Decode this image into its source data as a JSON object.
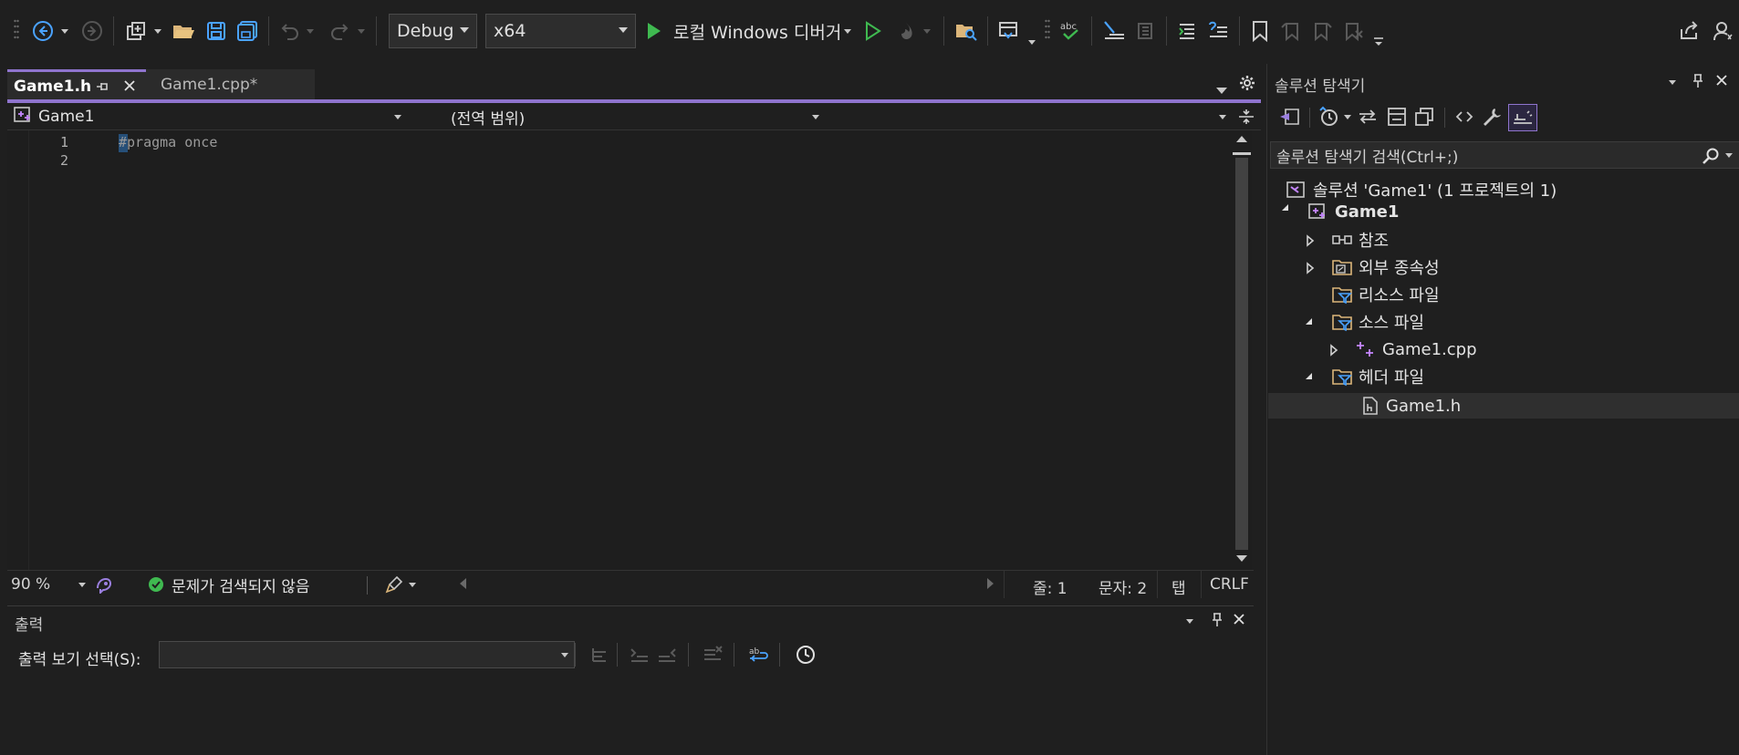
{
  "toolbar": {
    "config": "Debug",
    "platform": "x64",
    "run_label": "로컬 Windows 디버거"
  },
  "tabs": [
    {
      "label": "Game1.h",
      "active": true
    },
    {
      "label": "Game1.cpp*",
      "active": false
    }
  ],
  "navbar": {
    "project": "Game1",
    "scope": "(전역 범위)",
    "member": ""
  },
  "editor": {
    "lines": [
      {
        "number": "1",
        "text": "#pragma once"
      },
      {
        "number": "2",
        "text": ""
      }
    ]
  },
  "statusbar": {
    "zoom": "90 %",
    "issues": "문제가 검색되지 않음",
    "line": "줄: 1",
    "char": "문자: 2",
    "indent": "탭",
    "eol": "CRLF"
  },
  "output": {
    "title": "출력",
    "source_label": "출력 보기 선택(S):",
    "source_value": ""
  },
  "explorer": {
    "title": "솔루션 탐색기",
    "search_placeholder": "솔루션 탐색기 검색(Ctrl+;)",
    "tree": {
      "solution": "솔루션 'Game1' (1 프로젝트의 1)",
      "project": "Game1",
      "references": "참조",
      "external_deps": "외부 종속성",
      "resource_files": "리소스 파일",
      "source_files": "소스 파일",
      "source_cpp": "Game1.cpp",
      "header_files": "헤더 파일",
      "header_h": "Game1.h"
    }
  },
  "colors": {
    "accent": "#8f74ce",
    "background": "#1f1f1f",
    "editor_bg": "#1e1e1e",
    "run_green": "#3fb950",
    "selection": "#2f2f2f"
  }
}
